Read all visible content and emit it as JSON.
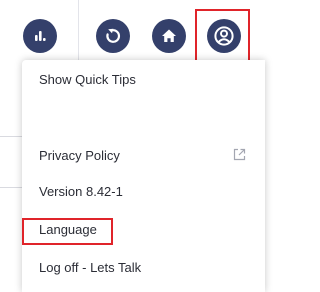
{
  "toolbar": {
    "buttons": [
      {
        "name": "analytics",
        "icon": "bar-chart-icon"
      },
      {
        "name": "refresh",
        "icon": "refresh-icon"
      },
      {
        "name": "home",
        "icon": "home-icon"
      },
      {
        "name": "profile",
        "icon": "user-circle-icon",
        "highlighted": true
      }
    ]
  },
  "menu": {
    "quick_tips": "Show Quick Tips",
    "privacy_policy": "Privacy Policy",
    "version": "Version 8.42-1",
    "language": "Language",
    "log_off": "Log off - Lets Talk"
  },
  "colors": {
    "button_bg": "#34406b",
    "highlight": "#e0242a",
    "menu_text": "#2b2d36"
  }
}
